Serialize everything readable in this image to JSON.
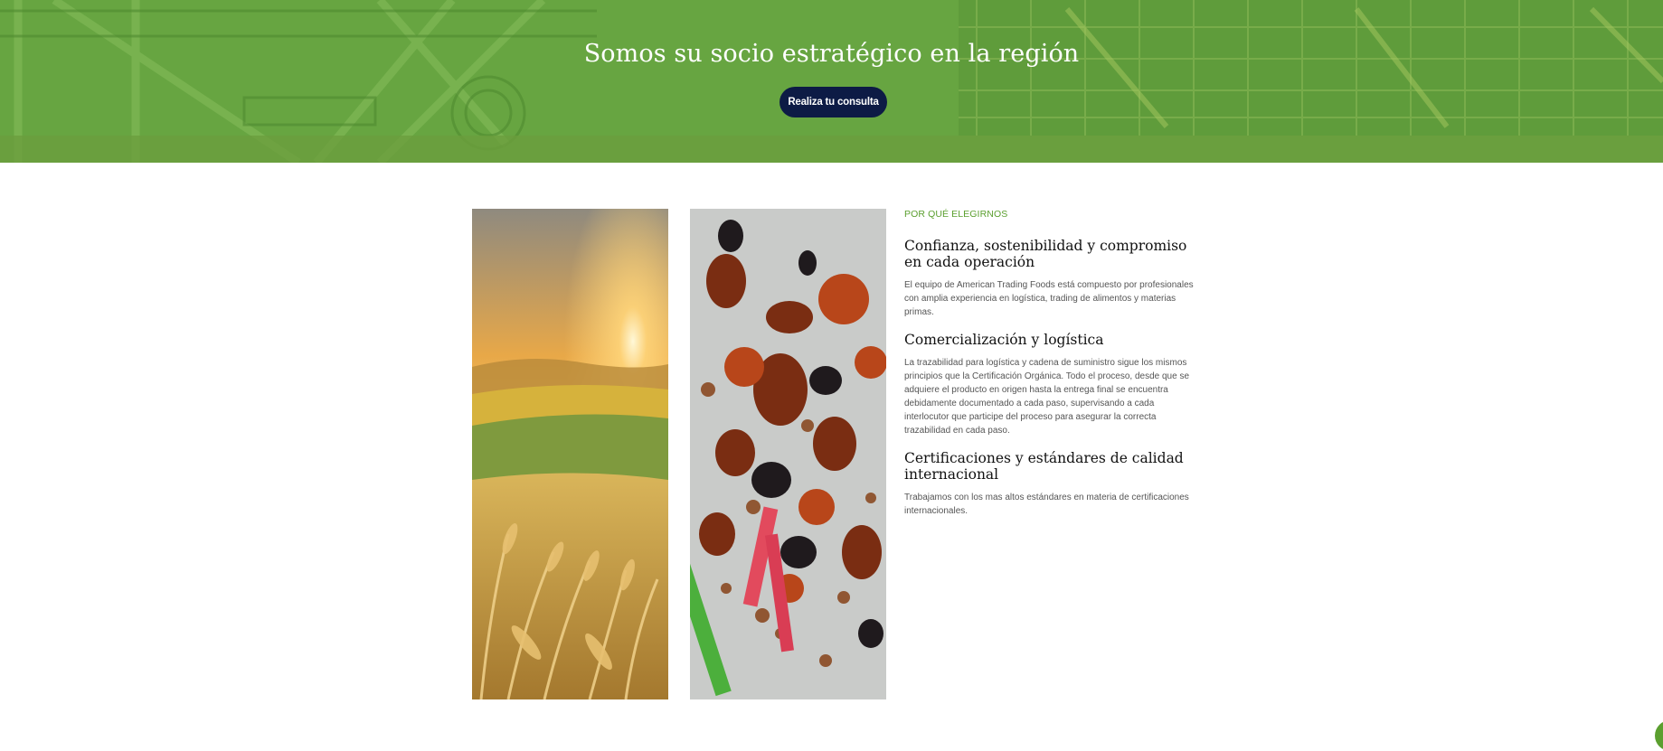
{
  "hero": {
    "title": "Somos su socio estratégico en la región",
    "cta_label": "Realiza tu consulta"
  },
  "why_us": {
    "eyebrow": "POR QUÉ ELEGIRNOS",
    "sections": [
      {
        "heading": "Confianza, sostenibilidad y compromiso en cada operación",
        "body": "El equipo de American Trading Foods está compuesto por profesionales con amplia experiencia en logística, trading de alimentos y materias primas."
      },
      {
        "heading": "Comercialización y logística",
        "body": "La trazabilidad para logística y cadena de suministro sigue los mismos principios que la Certificación Orgánica. Todo el proceso, desde que se adquiere el producto en origen hasta la entrega final se encuentra debidamente documentado a cada paso, supervisando a cada interlocutor que participe del proceso para asegurar la correcta trazabilidad en cada paso."
      },
      {
        "heading": "Certificaciones y estándares de calidad internacional",
        "body": "Trabajamos con los mas altos estándares en materia de certificaciones internacionales."
      }
    ]
  },
  "colors": {
    "hero_green": "#6aa843",
    "cta_navy": "#0d1b45",
    "accent_green": "#5b9f2f"
  },
  "icons": {
    "chat": "chat-bubble-icon"
  }
}
